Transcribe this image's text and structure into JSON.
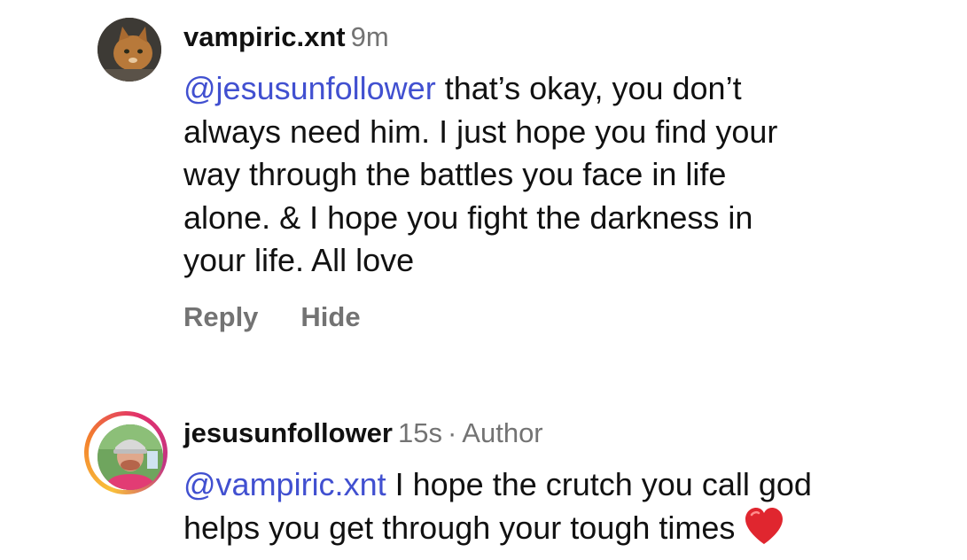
{
  "comments": [
    {
      "username": "vampiric.xnt",
      "time": "9m",
      "mention": "@jesusunfollower",
      "lines": [
        " that’s okay, you don’t",
        "always need him. I just hope you find your",
        "way through the battles you face in life",
        "alone. & I hope you fight the darkness in",
        "your life. All love"
      ],
      "actions": {
        "reply": "Reply",
        "hide": "Hide"
      }
    },
    {
      "username": "jesusunfollower",
      "time": "15s",
      "separator": "·",
      "role": "Author",
      "mention": "@vampiric.xnt",
      "lines": [
        " I hope the crutch you call god",
        "helps you get through your tough times"
      ],
      "emoji_icon": "red-heart-icon"
    }
  ],
  "colors": {
    "mention": "#4150d0",
    "meta": "#737373",
    "text": "#111111",
    "heart": "#e0262f"
  }
}
